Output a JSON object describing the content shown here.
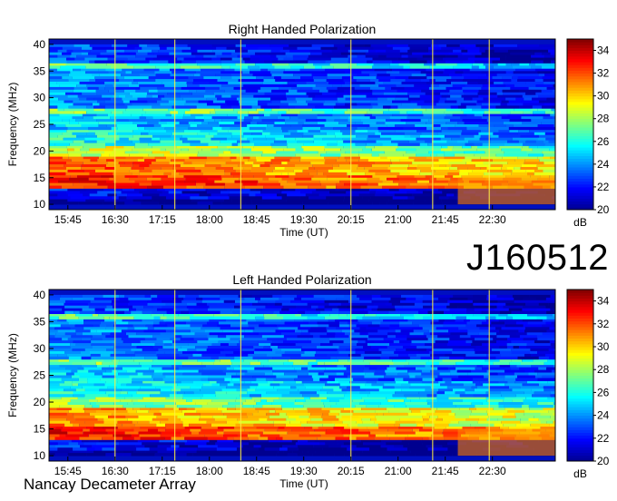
{
  "observation_id": "J160512",
  "instrument": "Nancay Decameter Array",
  "colors": {
    "colormap": [
      "#00008f",
      "#0000ff",
      "#0080ff",
      "#00ffff",
      "#80ff80",
      "#ffff00",
      "#ff8000",
      "#ff0000",
      "#800000"
    ]
  },
  "chart_data": [
    {
      "type": "heatmap",
      "title": "Right Handed Polarization",
      "xlabel": "Time (UT)",
      "ylabel": "Frequency (MHz)",
      "xticks": [
        "15:45",
        "16:30",
        "17:15",
        "18:00",
        "18:45",
        "19:30",
        "20:15",
        "21:00",
        "21:45",
        "22:30"
      ],
      "xlim": [
        "15:27",
        "23:30"
      ],
      "yticks": [
        10,
        15,
        20,
        25,
        30,
        35,
        40
      ],
      "ylim": [
        9,
        41
      ],
      "colorbar": {
        "label": "dB",
        "ticks": [
          20,
          22,
          24,
          26,
          28,
          30,
          32,
          34
        ],
        "range": [
          20,
          35
        ]
      },
      "bands": [
        {
          "f_from": 10,
          "f_to": 11,
          "db": 20
        },
        {
          "f_from": 11,
          "f_to": 13,
          "db": 22
        },
        {
          "f_from": 13,
          "f_to": 15.5,
          "db": 33
        },
        {
          "f_from": 15.5,
          "f_to": 19,
          "db": 32
        },
        {
          "f_from": 19,
          "f_to": 21,
          "db": 29
        },
        {
          "f_from": 21,
          "f_to": 24,
          "db": 26
        },
        {
          "f_from": 24,
          "f_to": 27,
          "db": 25
        },
        {
          "f_from": 27,
          "f_to": 28,
          "db": 28
        },
        {
          "f_from": 28,
          "f_to": 35.5,
          "db": 24
        },
        {
          "f_from": 35.5,
          "f_to": 36.5,
          "db": 27
        },
        {
          "f_from": 36.5,
          "f_to": 40,
          "db": 23
        }
      ],
      "vertical_lines": [
        "16:30",
        "17:27",
        "18:30",
        "20:15",
        "21:33",
        "22:27"
      ]
    },
    {
      "type": "heatmap",
      "title": "Left Handed Polarization",
      "xlabel": "Time (UT)",
      "ylabel": "Frequency (MHz)",
      "xticks": [
        "15:45",
        "16:30",
        "17:15",
        "18:00",
        "18:45",
        "19:30",
        "20:15",
        "21:00",
        "21:45",
        "22:30"
      ],
      "xlim": [
        "15:27",
        "23:30"
      ],
      "yticks": [
        10,
        15,
        20,
        25,
        30,
        35,
        40
      ],
      "ylim": [
        9,
        41
      ],
      "colorbar": {
        "label": "dB",
        "ticks": [
          20,
          22,
          24,
          26,
          28,
          30,
          32,
          34
        ],
        "range": [
          20,
          35
        ]
      },
      "bands": [
        {
          "f_from": 10,
          "f_to": 11,
          "db": 20
        },
        {
          "f_from": 11,
          "f_to": 13,
          "db": 22
        },
        {
          "f_from": 13,
          "f_to": 15.5,
          "db": 33
        },
        {
          "f_from": 15.5,
          "f_to": 19,
          "db": 31
        },
        {
          "f_from": 19,
          "f_to": 21,
          "db": 28
        },
        {
          "f_from": 21,
          "f_to": 24,
          "db": 26
        },
        {
          "f_from": 24,
          "f_to": 27,
          "db": 25
        },
        {
          "f_from": 27,
          "f_to": 28,
          "db": 28
        },
        {
          "f_from": 28,
          "f_to": 35.5,
          "db": 24
        },
        {
          "f_from": 35.5,
          "f_to": 36.5,
          "db": 27
        },
        {
          "f_from": 36.5,
          "f_to": 40,
          "db": 23
        }
      ],
      "vertical_lines": [
        "16:30",
        "17:27",
        "18:30",
        "20:15",
        "21:33",
        "22:27"
      ]
    }
  ]
}
